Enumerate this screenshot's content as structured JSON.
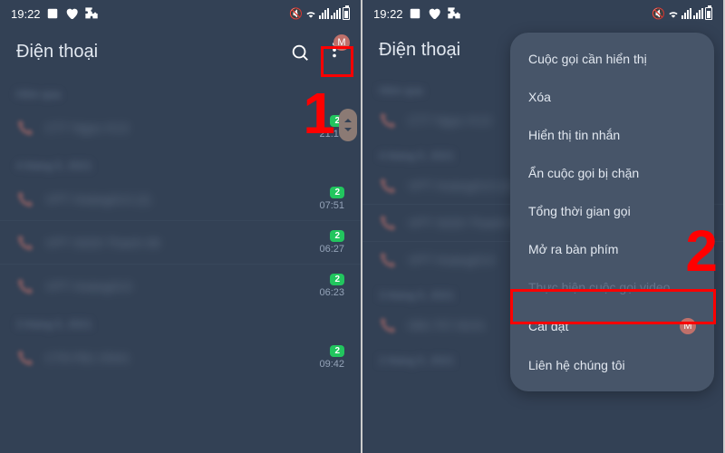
{
  "status": {
    "time": "19:22",
    "icons": [
      "gallery",
      "heart",
      "puzzle"
    ]
  },
  "header": {
    "title": "Điện thoại",
    "avatar_letter": "M"
  },
  "sections": {
    "yesterday": "Hôm qua",
    "date1": "4 tháng 5, 2021",
    "date2": "3 tháng 5, 2021",
    "date3": "2 tháng 5, 2021"
  },
  "calls": [
    {
      "name": "CT7 Ngọc K13",
      "badge": "2",
      "time": "21:19"
    },
    {
      "name": "VPT Hoàng013 (2)",
      "badge": "2",
      "time": "07:51"
    },
    {
      "name": "VPT S020 Thanh 08",
      "badge": "2",
      "time": "06:27"
    },
    {
      "name": "VPT Hoàng013",
      "badge": "2",
      "time": "06:23"
    },
    {
      "name": "CT8 FB1 D541",
      "badge": "2",
      "time": "09:42"
    },
    {
      "name": "090.757.8101",
      "badge": "2",
      "time": ""
    }
  ],
  "menu": {
    "items": [
      {
        "label": "Cuộc gọi cần hiển thị",
        "disabled": false
      },
      {
        "label": "Xóa",
        "disabled": false
      },
      {
        "label": "Hiển thị tin nhắn",
        "disabled": false
      },
      {
        "label": "Ẩn cuộc gọi bị chặn",
        "disabled": false
      },
      {
        "label": "Tổng thời gian gọi",
        "disabled": false
      },
      {
        "label": "Mở ra bàn phím",
        "disabled": false
      },
      {
        "label": "Thực hiện cuộc gọi video",
        "disabled": true
      },
      {
        "label": "Cài đặt",
        "disabled": false,
        "badge": "M"
      },
      {
        "label": "Liên hệ chúng tôi",
        "disabled": false
      }
    ]
  },
  "steps": {
    "one": "1",
    "two": "2"
  }
}
